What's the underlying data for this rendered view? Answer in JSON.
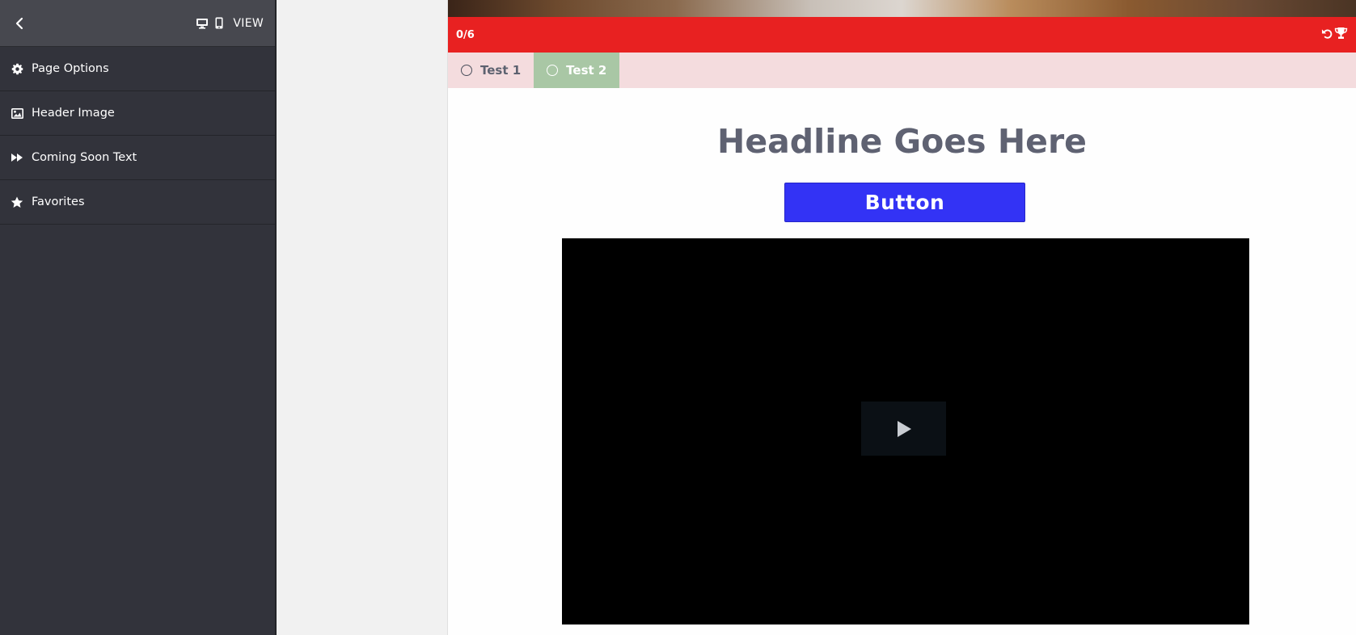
{
  "sidebar": {
    "view_label": "VIEW",
    "items": [
      {
        "label": "Page Options",
        "icon": "gear-icon"
      },
      {
        "label": "Header Image",
        "icon": "image-icon"
      },
      {
        "label": "Coming Soon Text",
        "icon": "fast-forward-icon"
      },
      {
        "label": "Favorites",
        "icon": "star-icon"
      }
    ]
  },
  "preview": {
    "score": "0/6",
    "tabs": [
      {
        "label": "Test 1",
        "selected": false
      },
      {
        "label": "Test 2",
        "selected": true
      }
    ],
    "headline": "Headline Goes Here",
    "button_label": "Button",
    "video": {
      "play_icon": "play-icon"
    }
  },
  "colors": {
    "sidebar_bg": "#32333b",
    "sidebar_header_bg": "#47484f",
    "red_bar": "#e82121",
    "tabs_bg": "#f4dcde",
    "active_tab": "#a9c7a5",
    "cta_button": "#3333f5",
    "headline": "#5f6272"
  }
}
